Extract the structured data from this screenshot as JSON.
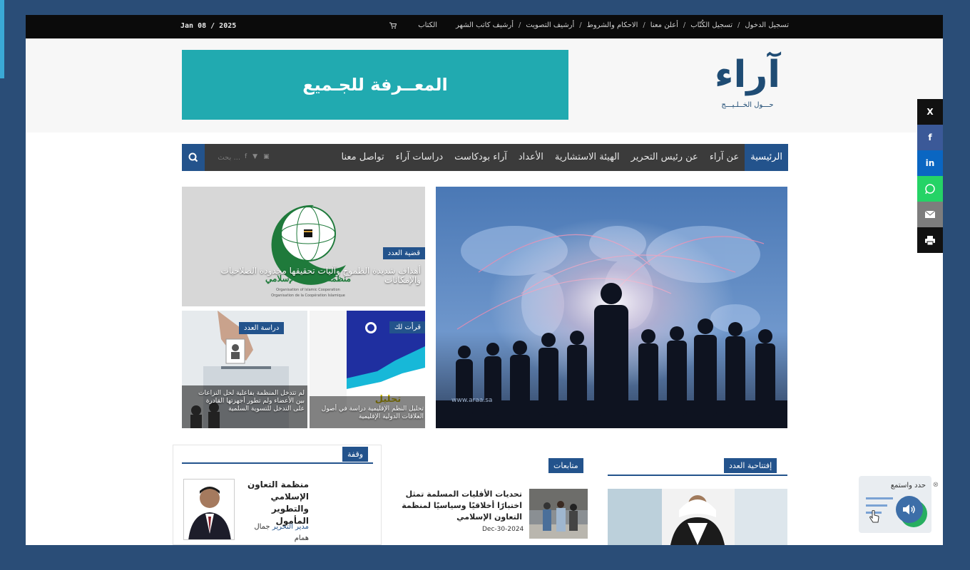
{
  "topbar": {
    "date": "Jan 08 / 2025",
    "links": [
      "تسجيل الدخول",
      "تسجيل الكُتّاب",
      "أعلن معنا",
      "الاحكام والشروط",
      "أرشيف التصويت",
      "أرشيف كاتب الشهر",
      "الكتاب"
    ]
  },
  "header": {
    "banner_text": "المعــرفة للجـميع",
    "logo_text": "آراء",
    "logo_subtitle": "حـــول الخــلـيـــج"
  },
  "nav": {
    "items": [
      "الرئيسية",
      "عن آراء",
      "عن رئيس التحرير",
      "الهيئة الاستشارية",
      "الأعداد",
      "آراء بودكاست",
      "دراسات آراء",
      "تواصل معنا"
    ],
    "search_placeholder": "بحث ..."
  },
  "featured": {
    "top": {
      "category": "قضية العدد",
      "title": "أهداف شديدة الطموح وآليات تحقيقها محدودة الصلاحيات والإمكانات"
    },
    "big": {
      "watermark": "www.araa.sa"
    },
    "bottom_left": {
      "category": "دراسة العدد",
      "title": "لم تتدخل المنظمة بفاعلية لحل النزاعات بين الأعضاء ولم تطور أجهزتها القادرة على التدخل للتسوية السلمية"
    },
    "bottom_mid": {
      "category": "قرأت لك",
      "title": "تحليل النظم الإقليمية دراسة في أصول العلاقات الدولية الإقليمية"
    }
  },
  "sections": {
    "editorial": {
      "label": "إفتتاحية العدد"
    },
    "follow_ups": {
      "label": "متابعات",
      "article_title": "تحديات الأقليات المسلمة تمثل اختبارًا أخلاقيًا وسياسيًا لمنظمة التعاون الإسلامي",
      "article_date": "Dec-30-2024"
    },
    "pause": {
      "label": "وقفة",
      "article_title": "منظمة التعاون الإسلامي والتطوير المأمول",
      "author_role": "مدير التحرير",
      "author_name": "جمال همام"
    }
  },
  "share": [
    "X",
    "f",
    "in",
    "whatsapp",
    "email",
    "print"
  ],
  "listen_widget": {
    "label": "حدد واستمع"
  },
  "colors": {
    "accent": "#23538c",
    "banner": "#21aab0",
    "page_bg": "#2a4d77"
  }
}
